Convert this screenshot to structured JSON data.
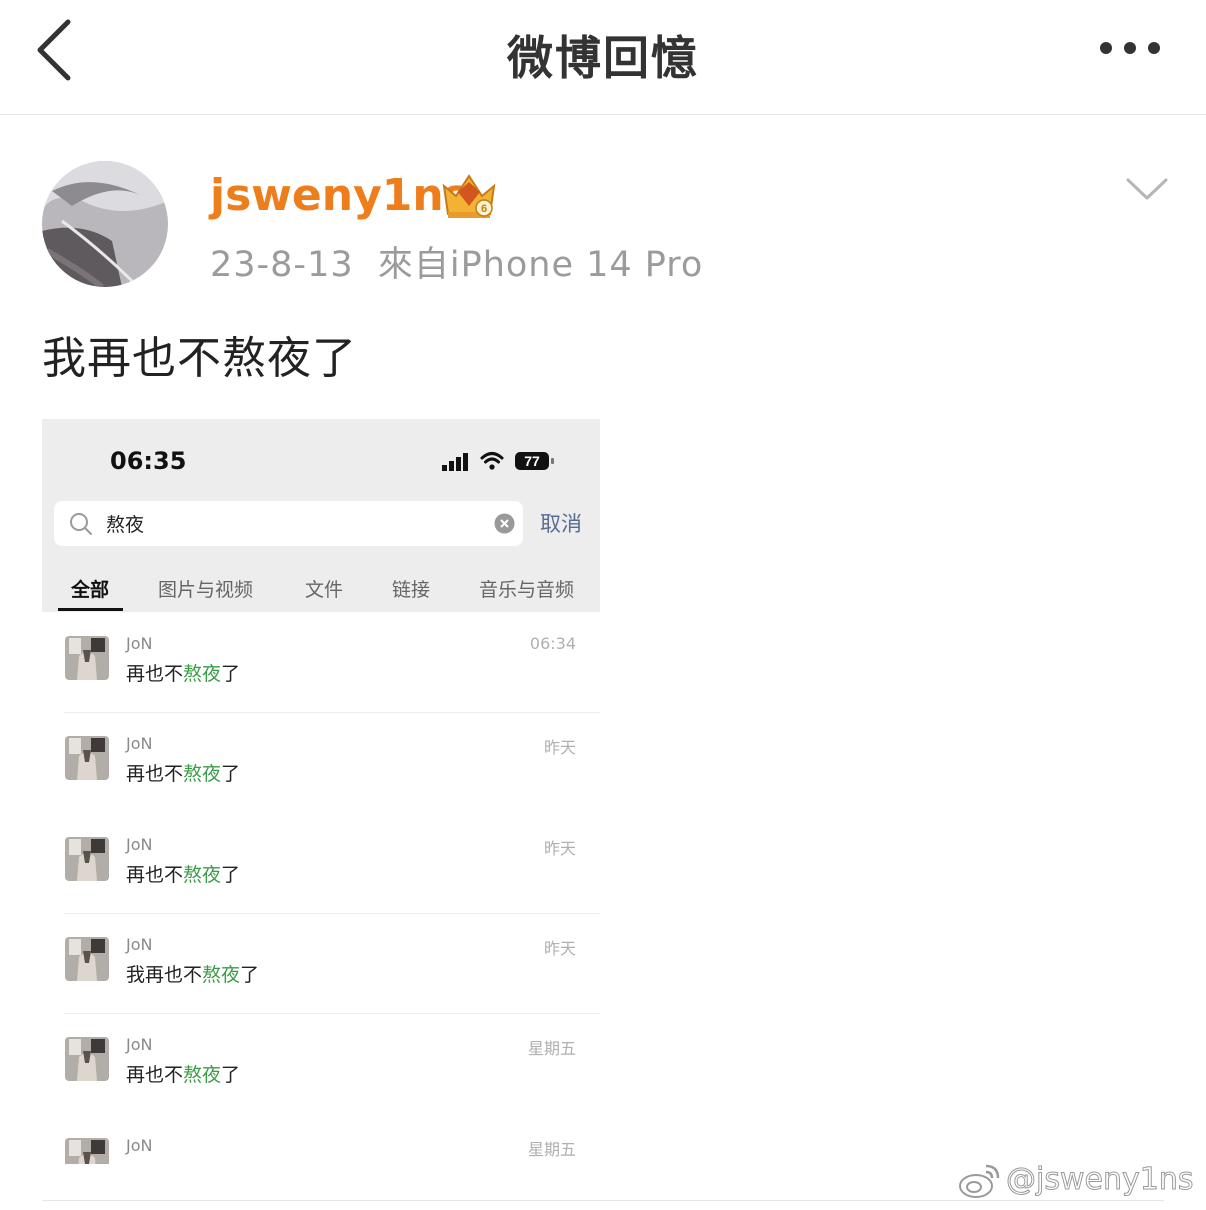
{
  "header": {
    "title": "微博回憶"
  },
  "post": {
    "username": "jsweny1ns",
    "date": "23-8-13",
    "source": "來自iPhone 14 Pro",
    "text": "我再也不熬夜了"
  },
  "screenshot": {
    "status_time": "06:35",
    "battery": "77",
    "search": {
      "query": "熬夜",
      "cancel": "取消"
    },
    "tabs": [
      "全部",
      "图片与视频",
      "文件",
      "链接",
      "音乐与音频"
    ],
    "results": [
      {
        "name": "JoN",
        "before": "再也不",
        "highlight": "熬夜",
        "after": "了",
        "time": "06:34"
      },
      {
        "name": "JoN",
        "before": "再也不",
        "highlight": "熬夜",
        "after": "了",
        "time": "昨天"
      },
      {
        "name": "JoN",
        "before": "再也不",
        "highlight": "熬夜",
        "after": "了",
        "time": "昨天"
      },
      {
        "name": "JoN",
        "before": "我再也不",
        "highlight": "熬夜",
        "after": "了",
        "time": "昨天"
      },
      {
        "name": "JoN",
        "before": "再也不",
        "highlight": "熬夜",
        "after": "了",
        "time": "星期五"
      },
      {
        "name": "JoN",
        "before": "",
        "highlight": "",
        "after": "",
        "time": "星期五"
      }
    ]
  },
  "watermark": "@jsweny1ns",
  "colors": {
    "username": "#ee7d1b",
    "highlight": "#3a9c44",
    "cancel": "#576b95"
  }
}
